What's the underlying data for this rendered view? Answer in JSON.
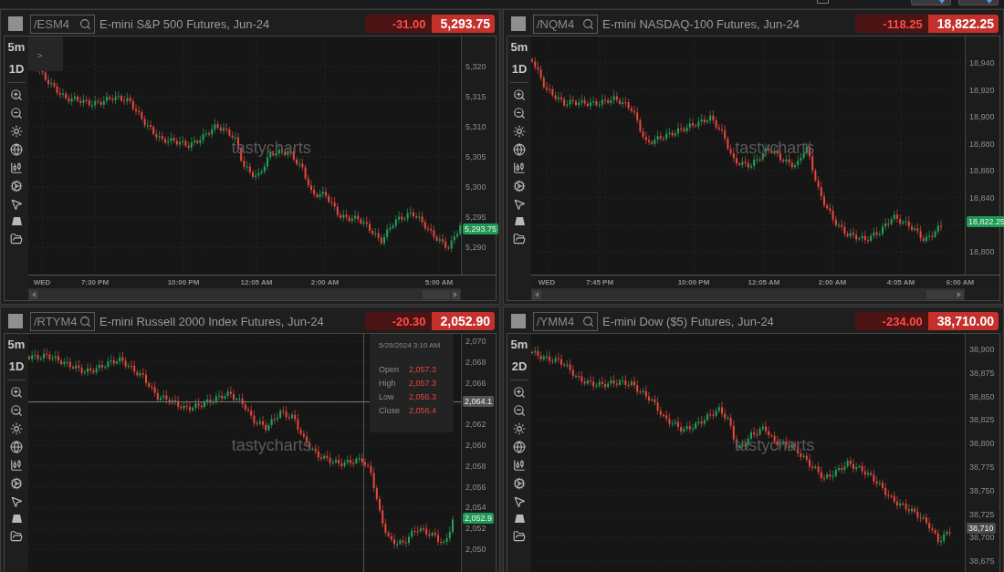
{
  "top_bar": {
    "checkbox_checked": false
  },
  "panels": [
    {
      "symbol": "/ESM4",
      "description": "E-mini S&P 500 Futures, Jun-24",
      "change": "-31.00",
      "price": "5,293.75",
      "interval": "5m",
      "range": "1D",
      "toggle_glyph": ">",
      "watermark": "tastycharts",
      "y_ticks": [
        "5,320",
        "5,315",
        "5,310",
        "5,305",
        "5,300",
        "5,295",
        "5,290"
      ],
      "x_ticks": [
        "WED",
        "7:30 PM",
        "10:00 PM",
        "12:05 AM",
        "2:00 AM",
        "5:00 AM"
      ],
      "last_price": {
        "text": "5,293.75",
        "color": "#1e9a56"
      }
    },
    {
      "symbol": "/NQM4",
      "description": "E-mini NASDAQ-100 Futures, Jun-24",
      "change": "-118.25",
      "price": "18,822.25",
      "interval": "5m",
      "range": "1D",
      "watermark": "tastycharts",
      "y_ticks": [
        "18,940",
        "18,920",
        "18,900",
        "18,880",
        "18,860",
        "18,840",
        "18,800"
      ],
      "x_ticks": [
        "WED",
        "7:45 PM",
        "10:00 PM",
        "12:05 AM",
        "2:00 AM",
        "4:05 AM",
        "6:00 AM"
      ],
      "last_price": {
        "text": "18,822.25",
        "color": "#1e9a56"
      }
    },
    {
      "symbol": "/RTYM4",
      "description": "E-mini Russell 2000 Index Futures, Jun-24",
      "change": "-20.30",
      "price": "2,052.90",
      "interval": "5m",
      "range": "1D",
      "watermark": "tastycharts",
      "y_ticks": [
        "2,070",
        "2,068",
        "2,066",
        "2,062",
        "2,060",
        "2,058",
        "2,056",
        "2,054",
        "2,052",
        "2,050"
      ],
      "last_price": {
        "text": "2,052.9",
        "color": "#1e9a56"
      },
      "crosshair": {
        "date": "5/29/2024 3:10 AM",
        "price_label": "2,064.1",
        "rows": [
          {
            "label": "Open",
            "value": "2,057.3"
          },
          {
            "label": "High",
            "value": "2,057.3"
          },
          {
            "label": "Low",
            "value": "2,056.3"
          },
          {
            "label": "Close",
            "value": "2,056.4"
          }
        ]
      }
    },
    {
      "symbol": "/YMM4",
      "description": "E-mini Dow ($5) Futures, Jun-24",
      "change": "-234.00",
      "price": "38,710.00",
      "interval": "5m",
      "range": "2D",
      "watermark": "tastycharts",
      "y_ticks": [
        "38,900",
        "38,875",
        "38,850",
        "38,825",
        "38,800",
        "38,775",
        "38,750",
        "38,725",
        "38,700",
        "38,675"
      ],
      "last_price": {
        "text": "38,710",
        "color": "#4a4a4a"
      }
    }
  ]
}
